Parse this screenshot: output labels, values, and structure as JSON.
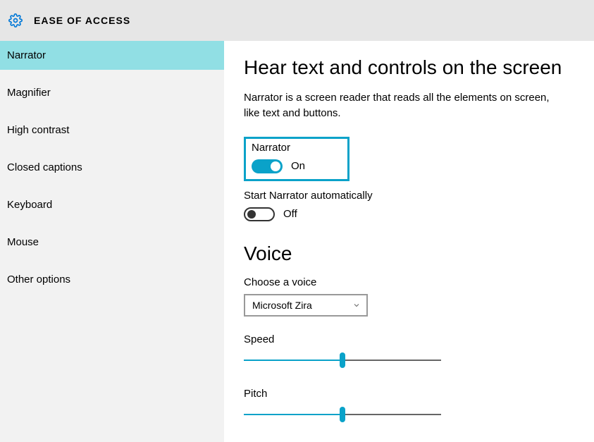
{
  "header": {
    "title": "EASE OF ACCESS"
  },
  "sidebar": {
    "items": [
      {
        "label": "Narrator",
        "active": true
      },
      {
        "label": "Magnifier",
        "active": false
      },
      {
        "label": "High contrast",
        "active": false
      },
      {
        "label": "Closed captions",
        "active": false
      },
      {
        "label": "Keyboard",
        "active": false
      },
      {
        "label": "Mouse",
        "active": false
      },
      {
        "label": "Other options",
        "active": false
      }
    ]
  },
  "main": {
    "title": "Hear text and controls on the screen",
    "description": "Narrator is a screen reader that reads all the elements on screen, like text and buttons.",
    "narrator_toggle": {
      "label": "Narrator",
      "state_label": "On",
      "on": true
    },
    "auto_toggle": {
      "label": "Start Narrator automatically",
      "state_label": "Off",
      "on": false
    },
    "voice": {
      "heading": "Voice",
      "choose_label": "Choose a voice",
      "selected": "Microsoft Zira ",
      "speed": {
        "label": "Speed",
        "percent": 50
      },
      "pitch": {
        "label": "Pitch",
        "percent": 50
      }
    }
  }
}
